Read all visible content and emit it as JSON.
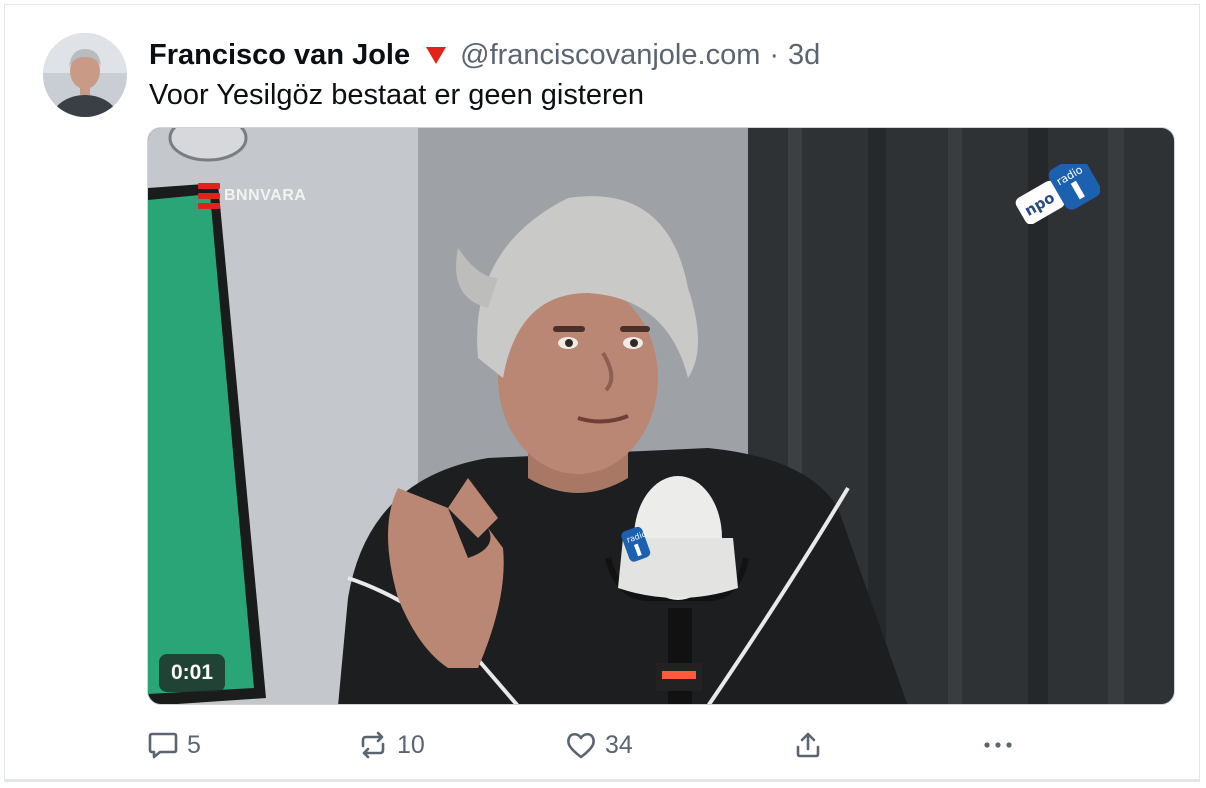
{
  "post": {
    "author_name": "Francisco van Jole",
    "badge_icon": "red-triangle-down-icon",
    "handle": "@franciscovanjole.com",
    "separator": "·",
    "time_ago": "3d",
    "text": "Voor Yesilgöz bestaat er geen gisteren"
  },
  "media": {
    "type": "video",
    "duration": "0:01",
    "channel_logo_text": "BNNVARA",
    "station_logo_text": "npo radio 1"
  },
  "actions": {
    "reply": {
      "icon": "comment-icon",
      "count": "5"
    },
    "repost": {
      "icon": "repost-icon",
      "count": "10"
    },
    "like": {
      "icon": "heart-icon",
      "count": "34"
    },
    "share": {
      "icon": "share-icon"
    },
    "more": {
      "icon": "more-dots-icon"
    }
  },
  "colors": {
    "accent_red": "#e1231b",
    "text_primary": "#0b0f14",
    "text_secondary": "#5b6470"
  }
}
